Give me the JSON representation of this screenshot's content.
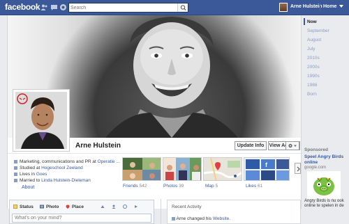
{
  "topbar": {
    "logo": "facebook",
    "search_placeholder": "Search",
    "username": "Arne Hulstein",
    "home_label": "Home"
  },
  "profile": {
    "name": "Arne Hulstein",
    "update_info_label": "Update Info",
    "view_activity_label": "View Activity",
    "info": {
      "work_prefix": "Marketing, communications and PR at",
      "work_link": "Operatie ...",
      "study_prefix": "Studied at",
      "study_link": "Hogeschool Zeeland",
      "lives_prefix": "Lives in",
      "lives_link": "Goes",
      "married_prefix": "Married to",
      "married_link": "Linda Hulstein-Dieleman"
    },
    "about_label": "About"
  },
  "tiles": [
    {
      "label": "Friends",
      "count": "542"
    },
    {
      "label": "Photos",
      "count": "39"
    },
    {
      "label": "Map",
      "count": "5"
    },
    {
      "label": "Likes",
      "count": "61"
    }
  ],
  "composer": {
    "tab_status": "Status",
    "tab_photo": "Photo",
    "tab_place": "Place",
    "placeholder": "What's on your mind?"
  },
  "recent_activity": {
    "title": "Recent Activity",
    "item_prefix": "Arne changed his",
    "item_link": "Website",
    "item_suffix": "."
  },
  "timeline_nav": [
    "Now",
    "September",
    "August",
    "July",
    "2010s",
    "2000s",
    "1990s",
    "1986",
    "Born"
  ],
  "sponsored": {
    "title": "Sponsored",
    "ad_title": "Speel Angry Birds online",
    "domain": "google.com",
    "description": "Angry Birds is nu ook online te spelen in de"
  },
  "colors": {
    "brand": "#3b5998",
    "link": "#3b5998",
    "page_bg": "#e9ebee"
  }
}
